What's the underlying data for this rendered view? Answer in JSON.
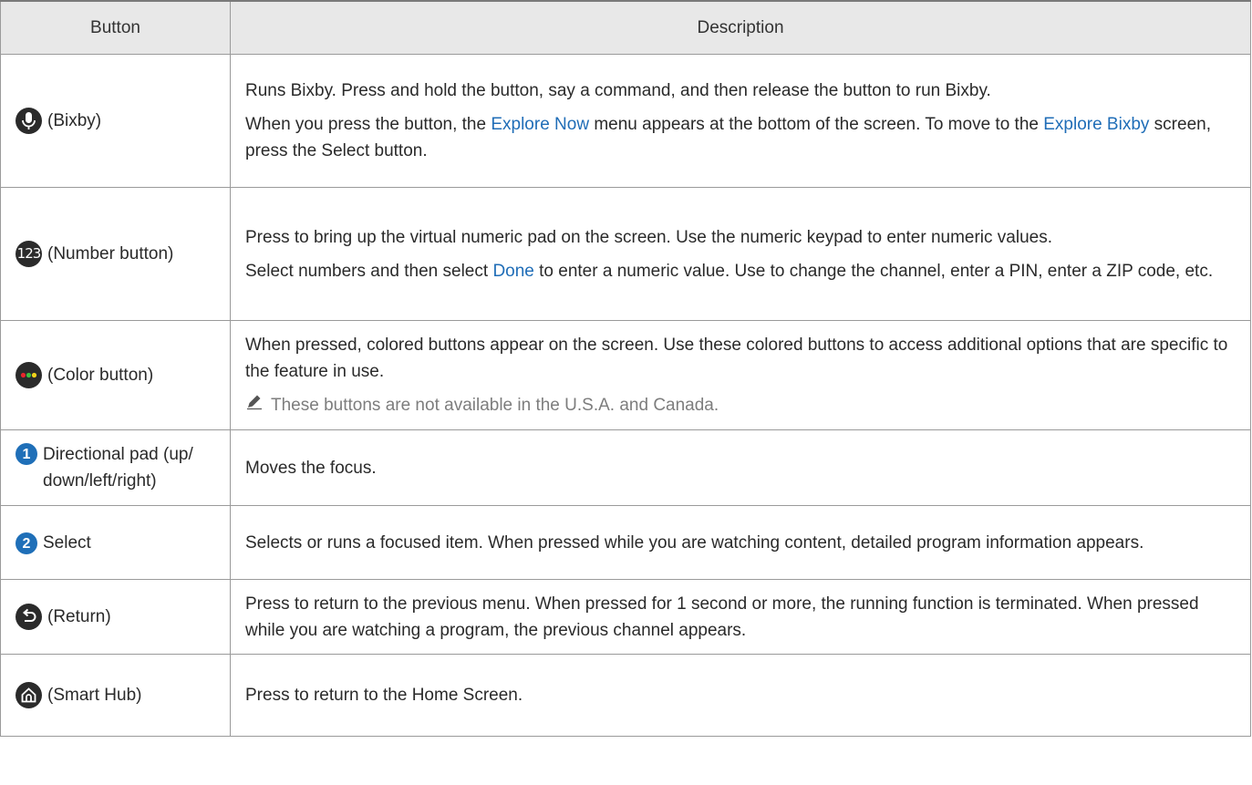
{
  "header": {
    "button_col": "Button",
    "description_col": "Description"
  },
  "rows": [
    {
      "button_label": "(Bixby)",
      "icon": "microphone-icon",
      "p1": "Runs Bixby. Press and hold the button, say a command, and then release the button to run Bixby.",
      "p2_before": "When you press the button, the ",
      "p2_link1": "Explore Now",
      "p2_middle": " menu appears at the bottom of the screen. To move to the ",
      "p2_link2": "Explore Bixby",
      "p2_after": " screen, press the Select button."
    },
    {
      "button_label": "(Number button)",
      "icon_text": "123",
      "p1": "Press to bring up the virtual numeric pad on the screen. Use the numeric keypad to enter numeric values.",
      "p2_before": "Select numbers and then select ",
      "p2_link": "Done",
      "p2_after": " to enter a numeric value. Use to change the channel, enter a PIN, enter a ZIP code, etc."
    },
    {
      "button_label": "(Color button)",
      "icon": "color-dots-icon",
      "p1": "When pressed, colored buttons appear on the screen. Use these colored buttons to access additional options that are specific to the feature in use.",
      "note": "These buttons are not available in the U.S.A. and Canada."
    },
    {
      "badge": "1",
      "button_label": "Directional pad (up/ down/left/right)",
      "description": "Moves the focus."
    },
    {
      "badge": "2",
      "button_label": "Select",
      "description": "Selects or runs a focused item. When pressed while you are watching content, detailed program information appears."
    },
    {
      "button_label": "(Return)",
      "icon": "return-icon",
      "description": "Press to return to the previous menu. When pressed for 1 second or more, the running function is terminated. When pressed while you are watching a program, the previous channel appears."
    },
    {
      "button_label": "(Smart Hub)",
      "icon": "home-icon",
      "description": "Press to return to the Home Screen."
    }
  ],
  "colors": {
    "link": "#1f6db7",
    "badge": "#1f6fb8",
    "dot_red": "#e8262d",
    "dot_green": "#3fbf3f",
    "dot_yellow": "#f2d21b"
  }
}
